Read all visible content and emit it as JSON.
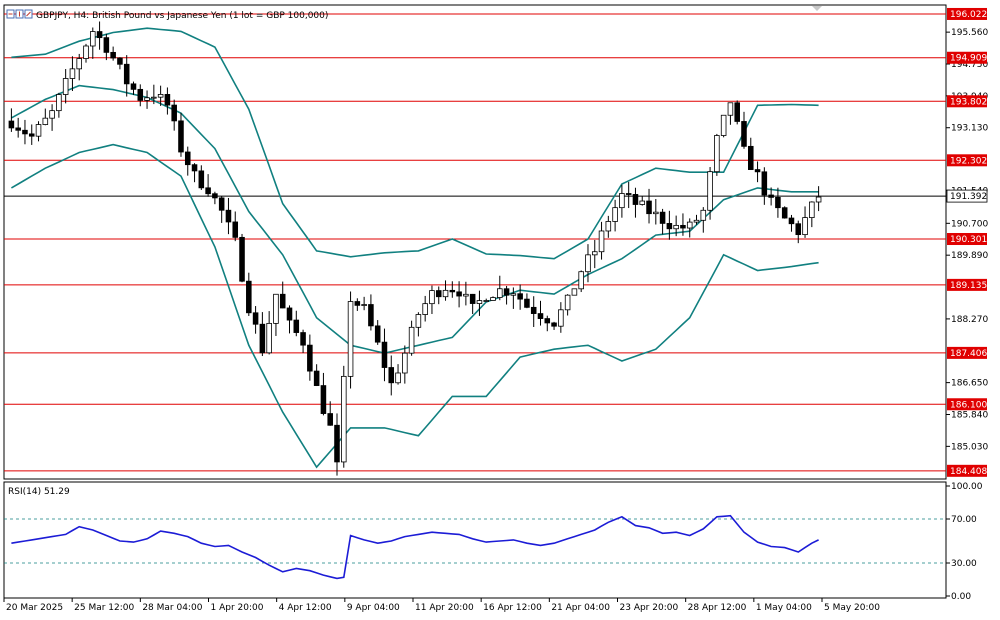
{
  "header": {
    "symbol_line": "GBPJPY, H4: British Pound vs Japanese Yen (1 lot = GBP 100,000)"
  },
  "chart_data": [
    {
      "type": "candlestick",
      "title": "GBPJPY, H4: British Pound vs Japanese Yen (1 lot = GBP 100,000)",
      "price_range": [
        184.2,
        196.25
      ],
      "y_tick_labels": [
        "195.560",
        "194.750",
        "193.940",
        "193.130",
        "191.540",
        "190.700",
        "189.890",
        "188.270",
        "186.650",
        "185.840",
        "185.030"
      ],
      "y_tick_values": [
        195.56,
        194.75,
        193.94,
        193.13,
        191.54,
        190.7,
        189.89,
        188.27,
        186.65,
        185.84,
        185.03
      ],
      "x_tick_labels": [
        "20 Mar 2025",
        "25 Mar 12:00",
        "28 Mar 04:00",
        "1 Apr 20:00",
        "4 Apr 12:00",
        "9 Apr 04:00",
        "11 Apr 20:00",
        "16 Apr 12:00",
        "21 Apr 04:00",
        "23 Apr 20:00",
        "28 Apr 12:00",
        "1 May 04:00",
        "5 May 20:00"
      ],
      "current_price": {
        "value": 191.392,
        "label": "191.392"
      },
      "horizontal_levels": [
        {
          "value": 196.022,
          "label": "196.022"
        },
        {
          "value": 194.909,
          "label": "194.909"
        },
        {
          "value": 193.802,
          "label": "193.802"
        },
        {
          "value": 192.302,
          "label": "192.302"
        },
        {
          "value": 190.301,
          "label": "190.301"
        },
        {
          "value": 189.135,
          "label": "189.135"
        },
        {
          "value": 187.406,
          "label": "187.406"
        },
        {
          "value": 186.1,
          "label": "186.100"
        },
        {
          "value": 184.408,
          "label": "184.408"
        }
      ],
      "price_path": [
        [
          0,
          193.3
        ],
        [
          3,
          192.9
        ],
        [
          6,
          193.5
        ],
        [
          9,
          194.6
        ],
        [
          12,
          195.6
        ],
        [
          14,
          195.2
        ],
        [
          17,
          194.3
        ],
        [
          19,
          193.9
        ],
        [
          21,
          194.0
        ],
        [
          23,
          193.7
        ],
        [
          25,
          192.6
        ],
        [
          27,
          191.9
        ],
        [
          29,
          191.6
        ],
        [
          31,
          191.0
        ],
        [
          33,
          190.2
        ],
        [
          35,
          188.6
        ],
        [
          37,
          187.5
        ],
        [
          39,
          188.9
        ],
        [
          41,
          188.1
        ],
        [
          43,
          187.7
        ],
        [
          45,
          186.5
        ],
        [
          47,
          185.5
        ],
        [
          48,
          184.5
        ],
        [
          50,
          188.8
        ],
        [
          52,
          188.5
        ],
        [
          54,
          187.6
        ],
        [
          56,
          186.6
        ],
        [
          58,
          187.4
        ],
        [
          60,
          188.4
        ],
        [
          62,
          188.9
        ],
        [
          64,
          189.1
        ],
        [
          66,
          189.0
        ],
        [
          68,
          188.5
        ],
        [
          70,
          188.9
        ],
        [
          72,
          189.0
        ],
        [
          74,
          189.0
        ],
        [
          76,
          188.6
        ],
        [
          78,
          188.4
        ],
        [
          80,
          188.2
        ],
        [
          82,
          188.7
        ],
        [
          84,
          189.5
        ],
        [
          86,
          190.0
        ],
        [
          88,
          190.8
        ],
        [
          90,
          191.4
        ],
        [
          92,
          191.2
        ],
        [
          94,
          191.0
        ],
        [
          96,
          190.8
        ],
        [
          98,
          190.6
        ],
        [
          100,
          190.6
        ],
        [
          102,
          191.0
        ],
        [
          104,
          192.8
        ],
        [
          106,
          193.8
        ],
        [
          108,
          192.5
        ],
        [
          110,
          191.9
        ],
        [
          112,
          191.2
        ],
        [
          114,
          190.8
        ],
        [
          116,
          190.5
        ],
        [
          118,
          191.1
        ],
        [
          119,
          191.4
        ]
      ],
      "bollinger_upper": [
        [
          0,
          194.92
        ],
        [
          5,
          195.0
        ],
        [
          10,
          195.33
        ],
        [
          15,
          195.55
        ],
        [
          20,
          195.66
        ],
        [
          25,
          195.58
        ],
        [
          30,
          195.18
        ],
        [
          35,
          193.6
        ],
        [
          40,
          191.2
        ],
        [
          45,
          190.0
        ],
        [
          50,
          189.85
        ],
        [
          55,
          189.95
        ],
        [
          60,
          190.0
        ],
        [
          65,
          190.3
        ],
        [
          70,
          189.92
        ],
        [
          75,
          189.88
        ],
        [
          80,
          189.8
        ],
        [
          85,
          190.3
        ],
        [
          90,
          191.7
        ],
        [
          95,
          192.1
        ],
        [
          100,
          192.0
        ],
        [
          105,
          192.0
        ],
        [
          110,
          193.7
        ],
        [
          115,
          193.72
        ],
        [
          119,
          193.7
        ]
      ],
      "bollinger_middle": [
        [
          0,
          193.38
        ],
        [
          5,
          193.85
        ],
        [
          10,
          194.2
        ],
        [
          15,
          194.1
        ],
        [
          20,
          193.9
        ],
        [
          25,
          193.5
        ],
        [
          30,
          192.6
        ],
        [
          35,
          191.0
        ],
        [
          40,
          189.9
        ],
        [
          45,
          188.3
        ],
        [
          50,
          187.6
        ],
        [
          55,
          187.4
        ],
        [
          60,
          187.6
        ],
        [
          65,
          187.8
        ],
        [
          70,
          188.7
        ],
        [
          75,
          189.0
        ],
        [
          80,
          188.9
        ],
        [
          85,
          189.4
        ],
        [
          90,
          189.8
        ],
        [
          95,
          190.4
        ],
        [
          100,
          190.5
        ],
        [
          105,
          191.3
        ],
        [
          110,
          191.6
        ],
        [
          115,
          191.5
        ],
        [
          119,
          191.5
        ]
      ],
      "bollinger_lower": [
        [
          0,
          191.6
        ],
        [
          5,
          192.1
        ],
        [
          10,
          192.5
        ],
        [
          15,
          192.7
        ],
        [
          20,
          192.5
        ],
        [
          25,
          191.9
        ],
        [
          30,
          190.1
        ],
        [
          35,
          187.6
        ],
        [
          40,
          185.9
        ],
        [
          45,
          184.5
        ],
        [
          50,
          185.5
        ],
        [
          55,
          185.5
        ],
        [
          60,
          185.3
        ],
        [
          65,
          186.3
        ],
        [
          70,
          186.3
        ],
        [
          75,
          187.3
        ],
        [
          80,
          187.5
        ],
        [
          85,
          187.6
        ],
        [
          90,
          187.2
        ],
        [
          95,
          187.5
        ],
        [
          100,
          188.3
        ],
        [
          105,
          189.9
        ],
        [
          110,
          189.5
        ],
        [
          115,
          189.6
        ],
        [
          119,
          189.7
        ]
      ]
    },
    {
      "type": "line",
      "title": "RSI(14) 51.29",
      "ylim": [
        0,
        100
      ],
      "y_tick_labels": [
        "100.00",
        "70.00",
        "30.00",
        "0.00"
      ],
      "y_tick_values": [
        100,
        70,
        30,
        0
      ],
      "reference_levels": [
        70,
        30
      ],
      "rsi_path": [
        [
          0,
          48
        ],
        [
          4,
          52
        ],
        [
          8,
          56
        ],
        [
          10,
          63
        ],
        [
          12,
          60
        ],
        [
          14,
          55
        ],
        [
          16,
          50
        ],
        [
          18,
          49
        ],
        [
          20,
          52
        ],
        [
          22,
          59
        ],
        [
          24,
          57
        ],
        [
          26,
          54
        ],
        [
          28,
          48
        ],
        [
          30,
          45
        ],
        [
          32,
          46
        ],
        [
          34,
          40
        ],
        [
          36,
          35
        ],
        [
          38,
          28
        ],
        [
          40,
          22
        ],
        [
          42,
          25
        ],
        [
          44,
          23
        ],
        [
          46,
          19
        ],
        [
          48,
          16
        ],
        [
          49,
          17
        ],
        [
          50,
          55
        ],
        [
          52,
          51
        ],
        [
          54,
          48
        ],
        [
          56,
          50
        ],
        [
          58,
          54
        ],
        [
          60,
          56
        ],
        [
          62,
          58
        ],
        [
          64,
          57
        ],
        [
          66,
          56
        ],
        [
          68,
          52
        ],
        [
          70,
          49
        ],
        [
          72,
          50
        ],
        [
          74,
          51
        ],
        [
          76,
          48
        ],
        [
          78,
          46
        ],
        [
          80,
          48
        ],
        [
          82,
          52
        ],
        [
          84,
          56
        ],
        [
          86,
          60
        ],
        [
          88,
          67
        ],
        [
          90,
          72
        ],
        [
          92,
          64
        ],
        [
          94,
          62
        ],
        [
          96,
          57
        ],
        [
          98,
          58
        ],
        [
          100,
          55
        ],
        [
          102,
          61
        ],
        [
          104,
          72
        ],
        [
          106,
          73
        ],
        [
          108,
          58
        ],
        [
          110,
          49
        ],
        [
          112,
          45
        ],
        [
          114,
          44
        ],
        [
          116,
          40
        ],
        [
          118,
          48
        ],
        [
          119,
          51
        ]
      ]
    }
  ]
}
